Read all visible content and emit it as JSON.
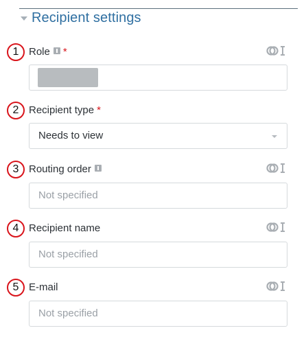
{
  "section": {
    "title": "Recipient settings"
  },
  "fields": [
    {
      "badge": "1",
      "label": "Role",
      "required": "*",
      "info_icon": "info-icon",
      "link_icon": "link-text-icon",
      "value_redacted": true
    },
    {
      "badge": "2",
      "label": "Recipient type",
      "required": "*",
      "value": "Needs to view",
      "caret_icon": "caret-down-icon"
    },
    {
      "badge": "3",
      "label": "Routing order",
      "info_icon": "info-icon",
      "link_icon": "link-text-icon",
      "placeholder": "Not specified"
    },
    {
      "badge": "4",
      "label": "Recipient name",
      "link_icon": "link-text-icon",
      "placeholder": "Not specified"
    },
    {
      "badge": "5",
      "label": "E-mail",
      "link_icon": "link-text-icon",
      "placeholder": "Not specified"
    }
  ],
  "colors": {
    "accent": "#2f6fa1",
    "required": "#d9141b",
    "badge_ring": "#d9141b",
    "border": "#d5d9dc",
    "placeholder": "#9aa0a6"
  }
}
